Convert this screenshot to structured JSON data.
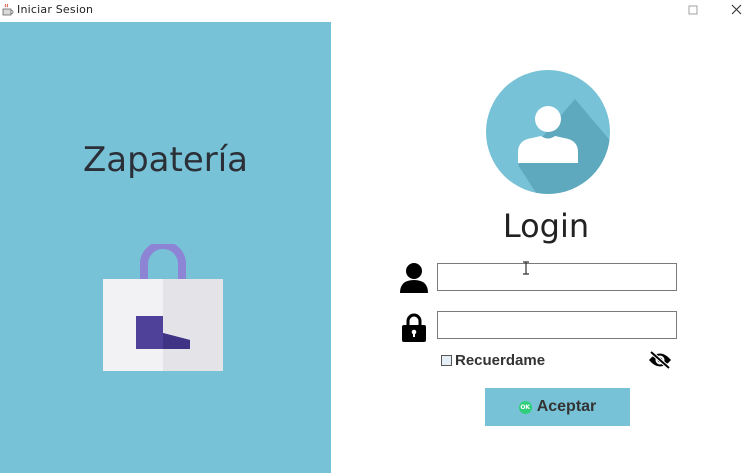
{
  "window": {
    "title": "Iniciar Sesion",
    "icon": "java-coffee-icon",
    "controls": [
      "maximize-icon",
      "close-icon"
    ]
  },
  "brand": {
    "title": "Zapatería",
    "illustration": "shopping-bag-with-shoe-icon"
  },
  "login": {
    "avatar": "user-avatar-icon",
    "title": "Login",
    "username": {
      "icon": "user-icon",
      "value": ""
    },
    "password": {
      "icon": "lock-icon",
      "value": ""
    },
    "remember": {
      "label": "Recuerdame",
      "checked": false
    },
    "toggle_password_icon": "eye-slash-icon",
    "submit": {
      "label": "Aceptar",
      "icon_text": "OK"
    }
  },
  "colors": {
    "panel": "#78c2d7",
    "bag_handle": "#8e84d6",
    "shoe": "#4f4199",
    "ok_badge": "#2fcf7a"
  }
}
